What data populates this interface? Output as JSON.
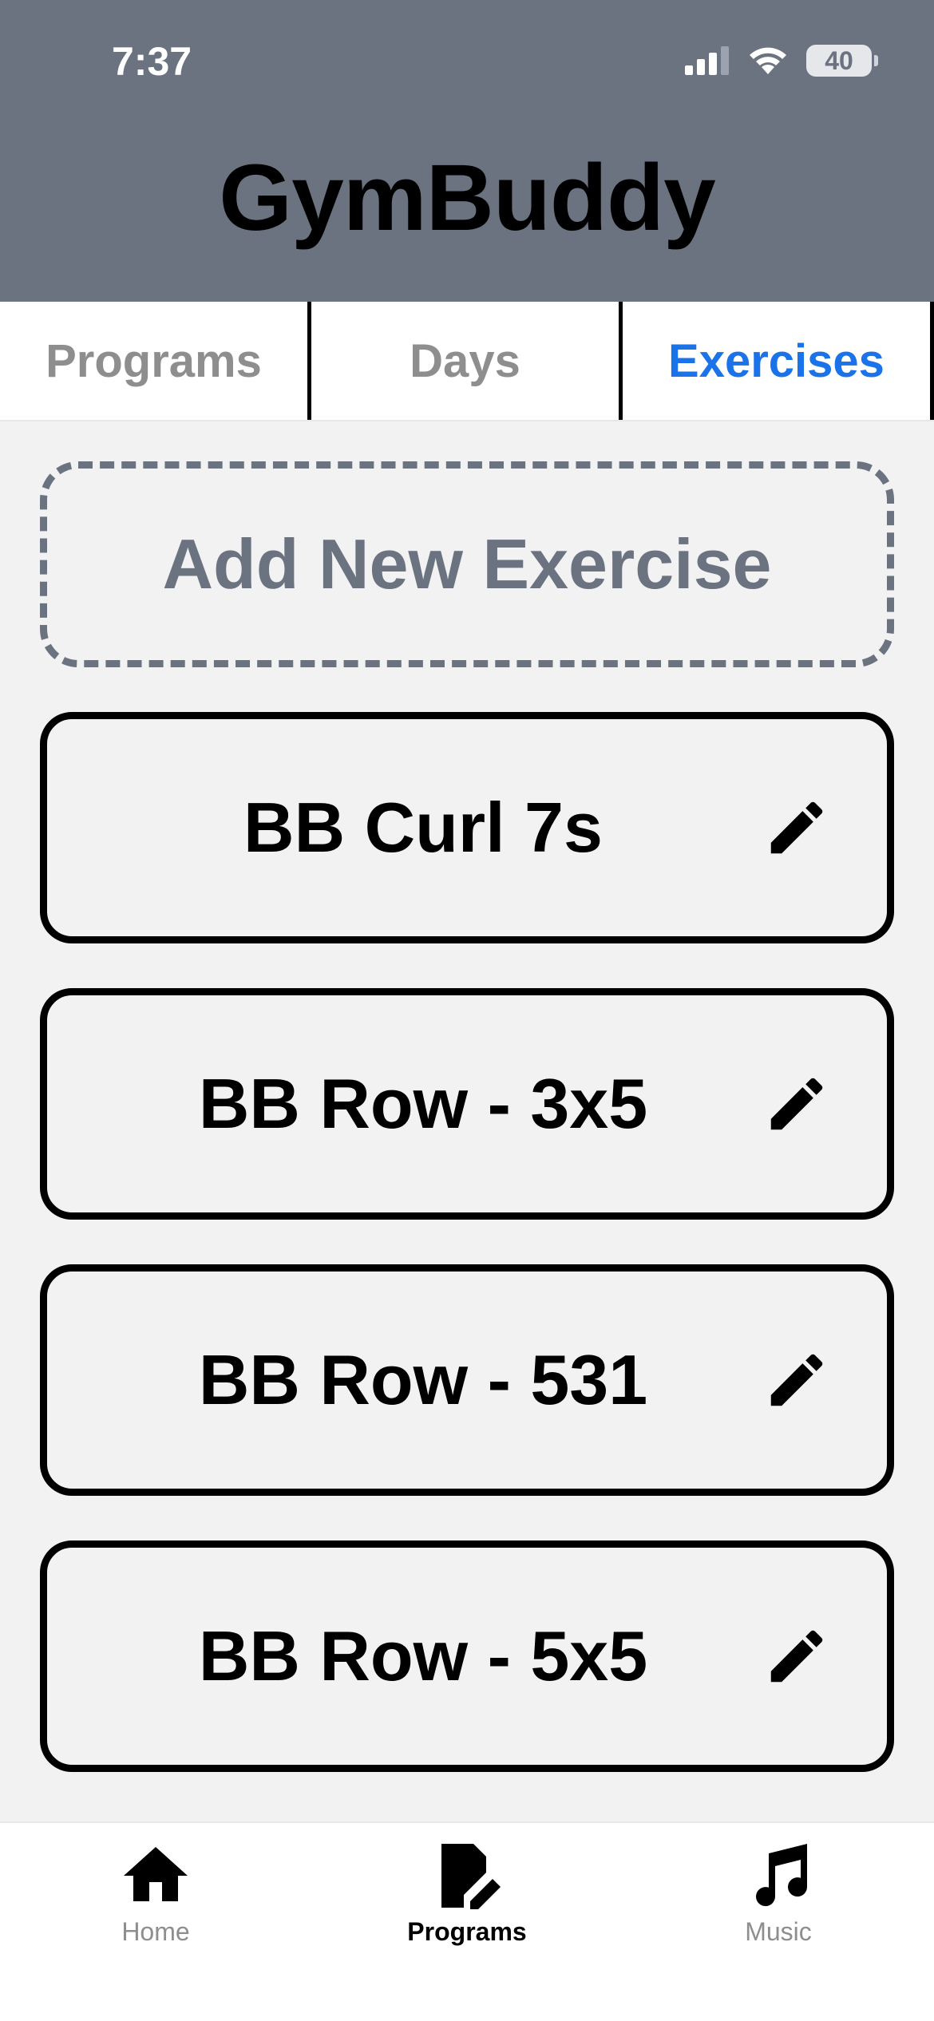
{
  "status_bar": {
    "time": "7:37",
    "battery": "40"
  },
  "header": {
    "title": "GymBuddy"
  },
  "tabs": [
    {
      "label": "Programs",
      "active": false
    },
    {
      "label": "Days",
      "active": false
    },
    {
      "label": "Exercises",
      "active": true
    }
  ],
  "add_new": {
    "label": "Add New Exercise"
  },
  "exercises": [
    {
      "name": "BB Curl 7s"
    },
    {
      "name": "BB Row - 3x5"
    },
    {
      "name": "BB Row - 531"
    },
    {
      "name": "BB Row - 5x5"
    }
  ],
  "bottom_nav": [
    {
      "label": "Home",
      "icon": "home-icon",
      "active": false
    },
    {
      "label": "Programs",
      "icon": "edit-document-icon",
      "active": true
    },
    {
      "label": "Music",
      "icon": "music-note-icon",
      "active": false
    }
  ],
  "colors": {
    "header_bg": "#6b7280",
    "active_tab": "#1a73e8",
    "inactive_tab": "#8e8e8e",
    "background": "#f2f2f2"
  }
}
